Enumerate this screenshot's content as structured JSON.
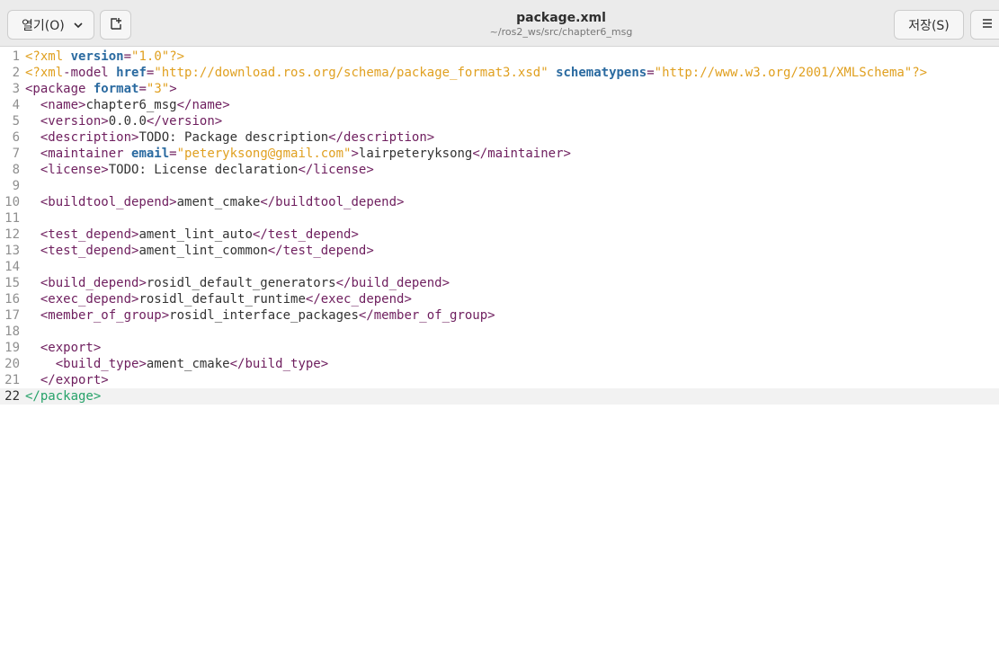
{
  "header": {
    "open_label": "열기(O)",
    "title": "package.xml",
    "path": "~/ros2_ws/src/chapter6_msg",
    "save_label": "저장(S)",
    "icons": [
      "chevron-down-icon",
      "new-tab-icon",
      "hamburger-menu-icon"
    ]
  },
  "editor": {
    "current_line": 22,
    "lines": [
      {
        "n": "1",
        "t": "<?xml version=\"1.0\"?>"
      },
      {
        "n": "2",
        "t": "<?xml-model href=\"http://download.ros.org/schema/package_format3.xsd\" schematypens=\"http://www.w3.org/2001/XMLSchema\"?>"
      },
      {
        "n": "3",
        "t": "<package format=\"3\">"
      },
      {
        "n": "4",
        "t": "  <name>chapter6_msg</name>"
      },
      {
        "n": "5",
        "t": "  <version>0.0.0</version>"
      },
      {
        "n": "6",
        "t": "  <description>TODO: Package description</description>"
      },
      {
        "n": "7",
        "t": "  <maintainer email=\"peteryksong@gmail.com\">lairpeteryksong</maintainer>"
      },
      {
        "n": "8",
        "t": "  <license>TODO: License declaration</license>"
      },
      {
        "n": "9",
        "t": ""
      },
      {
        "n": "10",
        "t": "  <buildtool_depend>ament_cmake</buildtool_depend>"
      },
      {
        "n": "11",
        "t": ""
      },
      {
        "n": "12",
        "t": "  <test_depend>ament_lint_auto</test_depend>"
      },
      {
        "n": "13",
        "t": "  <test_depend>ament_lint_common</test_depend>"
      },
      {
        "n": "14",
        "t": ""
      },
      {
        "n": "15",
        "t": "  <build_depend>rosidl_default_generators</build_depend>"
      },
      {
        "n": "16",
        "t": "  <exec_depend>rosidl_default_runtime</exec_depend>"
      },
      {
        "n": "17",
        "t": "  <member_of_group>rosidl_interface_packages</member_of_group>"
      },
      {
        "n": "18",
        "t": ""
      },
      {
        "n": "19",
        "t": "  <export>"
      },
      {
        "n": "20",
        "t": "    <build_type>ament_cmake</build_type>"
      },
      {
        "n": "21",
        "t": "  </export>"
      },
      {
        "n": "22",
        "t": "</package>"
      }
    ]
  },
  "colors": {
    "processing_instruction": "#e0a020",
    "tag": "#6e1e5e",
    "attribute": "#2a6aa0",
    "string": "#e0a020",
    "last_tag": "#26a269",
    "line_number": "#8f8f8f",
    "current_line_bg": "#f2f2f2",
    "header_bg": "#ebebeb"
  }
}
